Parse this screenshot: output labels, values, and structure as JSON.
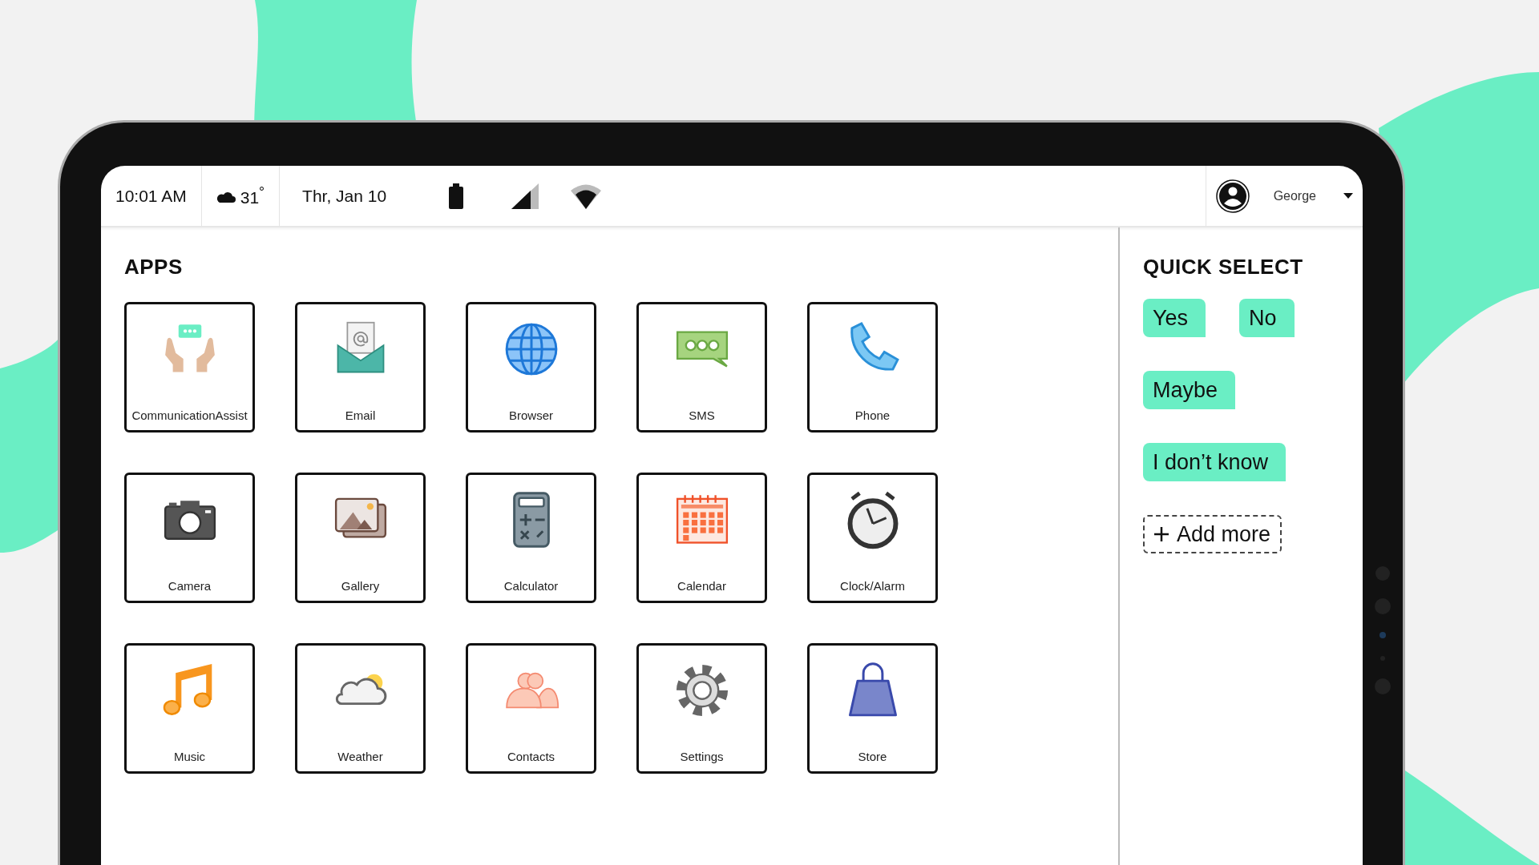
{
  "status_bar": {
    "time": "10:01 AM",
    "temperature": "31$^{°}$",
    "date": "Thr, Jan 10",
    "user": "George"
  },
  "apps_title": "APPS",
  "apps": [
    "CommunicationAssist",
    "Email",
    "Browser",
    "SMS",
    "Phone",
    "Camera",
    "Gallery",
    "Calculator",
    "Calendar",
    "Clock/Alarm",
    "Music",
    "Weather",
    "Contacts",
    "Settings",
    "Store"
  ],
  "quick_select": {
    "title": "QUICK SELECT",
    "options": [
      "Yes",
      "No",
      "Maybe",
      "I don’t know"
    ],
    "add_label": "Add more"
  }
}
